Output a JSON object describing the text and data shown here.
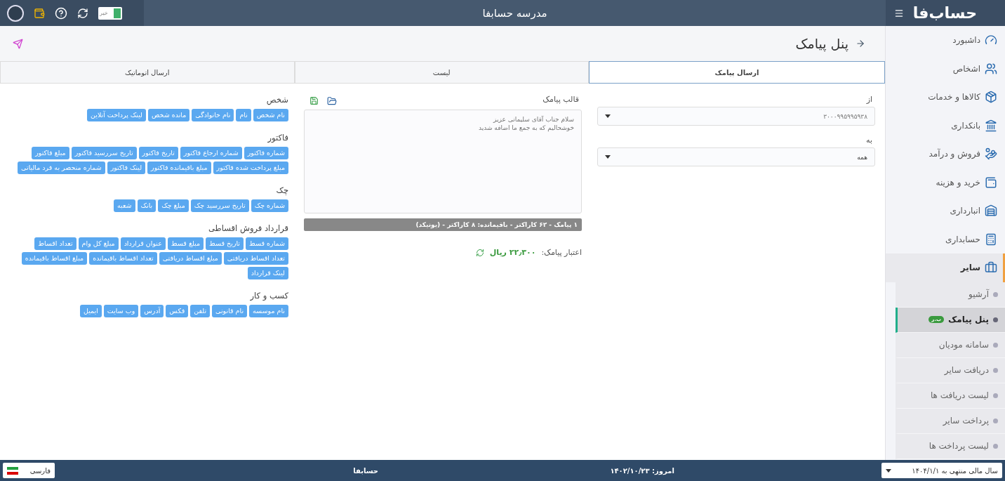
{
  "topbar": {
    "brand": "حساب‌فا",
    "title": "مدرسه حسابفا",
    "switch": {
      "label": "خیر",
      "on": true
    }
  },
  "page": {
    "title": "پنل پیامک"
  },
  "tabs": [
    {
      "label": "ارسال پیامک",
      "selected": true
    },
    {
      "label": "لیست",
      "selected": false
    },
    {
      "label": "ارسال اتوماتیک",
      "selected": false
    }
  ],
  "form": {
    "from_label": "از",
    "from_value": "۳۰۰۰۹۹۵۹۹۵۹۳۸",
    "to_label": "به",
    "to_value": "همه",
    "template_label": "قالب پیامک",
    "message": [
      "سلام جناب آقای سلیمانی عزیز",
      "خوشحالیم که به جمع ما اضافه شدید"
    ],
    "counter": "۱ پیامک - ۶۲ کاراکتر - باقیمانده: ۸ کاراکتر - (یونیکد)",
    "credit_label": "اعتبار پیامک:",
    "credit_value": "۲۲٫۳۰۰ ریال"
  },
  "tag_groups": [
    {
      "title": "شخص",
      "tags": [
        "نام شخص",
        "نام",
        "نام خانوادگی",
        "مانده شخص",
        "لینک پرداخت آنلاین"
      ]
    },
    {
      "title": "فاکتور",
      "tags": [
        "شماره فاکتور",
        "شماره ارجاع فاکتور",
        "تاریخ فاکتور",
        "تاریخ سررسید فاکتور",
        "مبلغ فاکتور",
        "مبلغ پرداخت شده فاکتور",
        "مبلغ باقیمانده فاکتور",
        "لینک فاکتور",
        "شماره منحصر به فرد مالیاتی"
      ]
    },
    {
      "title": "چک",
      "tags": [
        "شماره چک",
        "تاریخ سررسید چک",
        "مبلغ چک",
        "بانک",
        "شعبه"
      ]
    },
    {
      "title": "قرارداد فروش اقساطی",
      "tags": [
        "شماره قسط",
        "تاریخ قسط",
        "مبلغ قسط",
        "عنوان قرارداد",
        "مبلغ کل وام",
        "تعداد اقساط",
        "تعداد اقساط دریافتی",
        "مبلغ اقساط دریافتی",
        "تعداد اقساط باقیمانده",
        "مبلغ اقساط باقیمانده",
        "لینک قرارداد"
      ]
    },
    {
      "title": "کسب و کار",
      "tags": [
        "نام موسسه",
        "نام قانونی",
        "تلفن",
        "فکس",
        "آدرس",
        "وب سایت",
        "ایمیل"
      ]
    }
  ],
  "sidebar": {
    "items": [
      {
        "label": "داشبورد",
        "expanded": false
      },
      {
        "label": "اشخاص",
        "expanded": false
      },
      {
        "label": "کالاها و خدمات",
        "expanded": false
      },
      {
        "label": "بانکداری",
        "expanded": false
      },
      {
        "label": "فروش و درآمد",
        "expanded": false
      },
      {
        "label": "خرید و هزینه",
        "expanded": false
      },
      {
        "label": "انبارداری",
        "expanded": false
      },
      {
        "label": "حسابداری",
        "expanded": false
      },
      {
        "label": "سایر",
        "expanded": true,
        "children": [
          {
            "label": "آرشیو",
            "selected": false
          },
          {
            "label": "پنل پیامک",
            "selected": true,
            "badge": "ب.ر"
          },
          {
            "label": "سامانه مودیان",
            "selected": false
          },
          {
            "label": "دریافت سایر",
            "selected": false
          },
          {
            "label": "لیست دریافت ها",
            "selected": false
          },
          {
            "label": "پرداخت سایر",
            "selected": false
          },
          {
            "label": "لیست پرداخت ها",
            "selected": false
          }
        ]
      }
    ]
  },
  "footer": {
    "fiscal_year": "سال مالی منتهی به ۱۴۰۴/۱/۱",
    "company": "حسابفا",
    "today_label": "امروز:",
    "today_value": "۱۴۰۲/۱۰/۲۳",
    "language": "فارسی"
  }
}
